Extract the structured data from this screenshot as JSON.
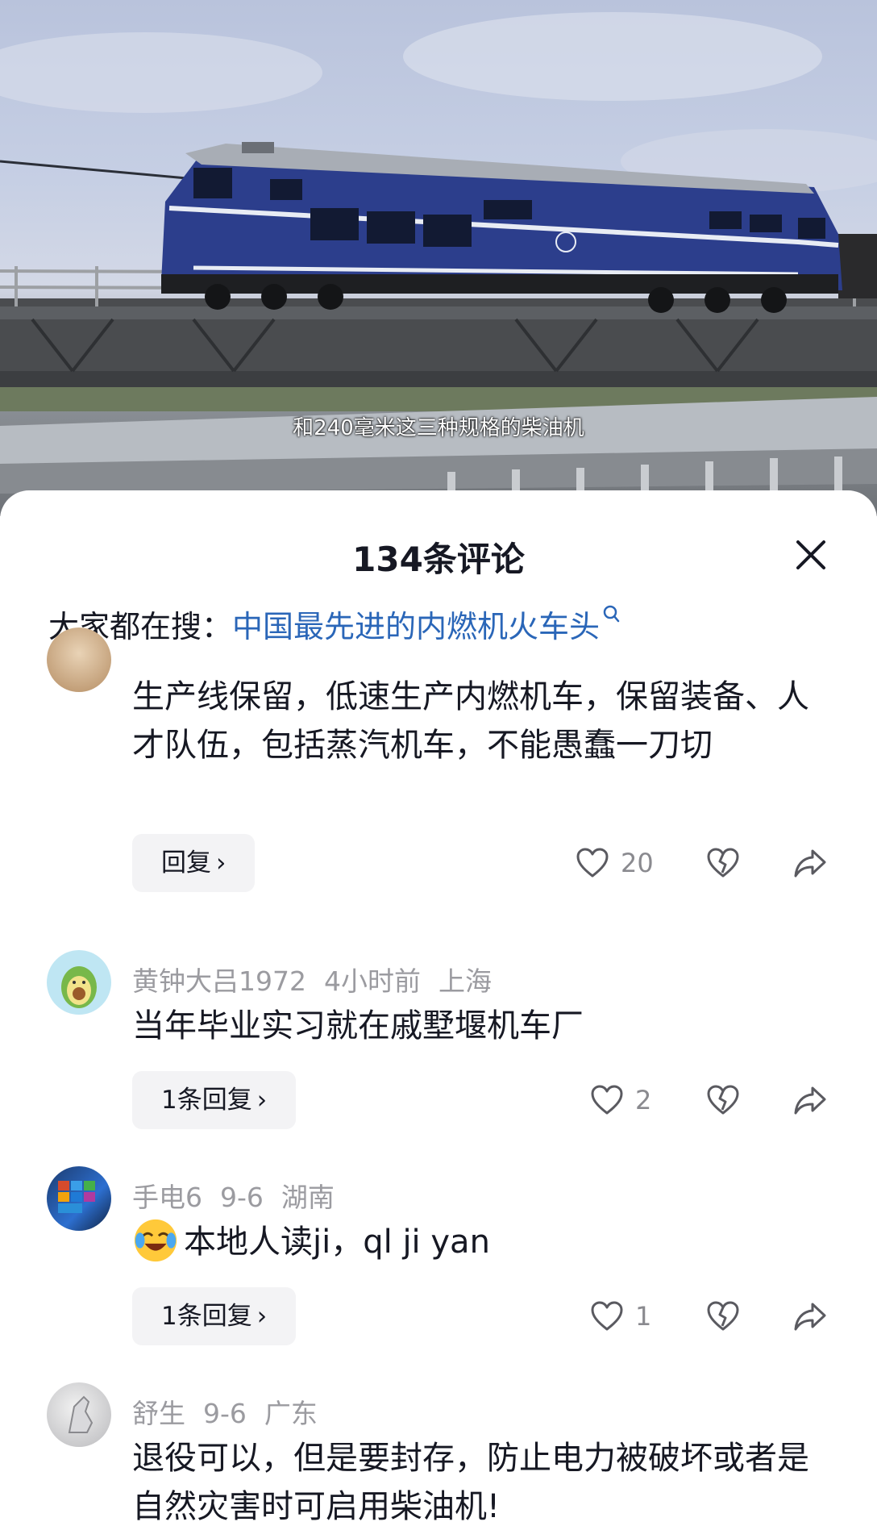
{
  "video": {
    "subtitle": "和240毫米这三种规格的柴油机"
  },
  "sheet": {
    "title": "134条评论",
    "trending_label": "大家都在搜：",
    "trending_term": "中国最先进的内燃机火车头"
  },
  "comments": [
    {
      "text": "生产线保留，低速生产内燃机车，保留装备、人才队伍，包括蒸汽机车，不能愚蠢一刀切",
      "reply_label": "回复",
      "likes": "20"
    },
    {
      "username": "黄钟大吕1972",
      "time": "4小时前",
      "location": "上海",
      "text": "当年毕业实习就在戚墅堰机车厂",
      "reply_label": "1条回复",
      "likes": "2"
    },
    {
      "username": "手电6",
      "time": "9-6",
      "location": "湖南",
      "text": "本地人读ji，ql ji yan",
      "reply_label": "1条回复",
      "likes": "1"
    },
    {
      "username": "舒生",
      "time": "9-6",
      "location": "广东",
      "text": "退役可以，但是要封存，防止电力被破坏或者是自然灾害时可启用柴油机!"
    }
  ],
  "icons": {
    "close": "close-icon",
    "search": "search-icon",
    "like": "heart-outline-icon",
    "dislike": "broken-heart-icon",
    "share": "share-arrow-icon",
    "chevron": "chevron-right-icon"
  },
  "colors": {
    "link": "#2a66b8",
    "muted": "#9b9ba0",
    "reply_bg": "#f3f3f5"
  }
}
